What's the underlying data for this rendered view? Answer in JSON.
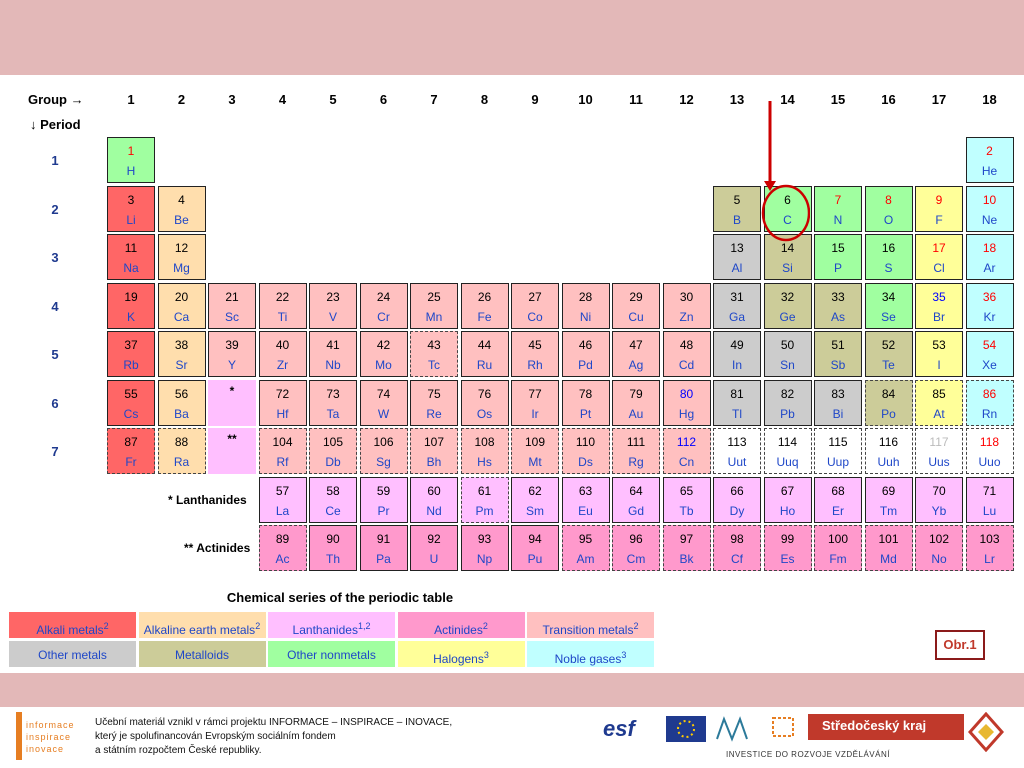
{
  "header": {
    "group_label": "Group →",
    "period_label": "↓ Period"
  },
  "groups": [
    "1",
    "2",
    "3",
    "4",
    "5",
    "6",
    "7",
    "8",
    "9",
    "10",
    "11",
    "12",
    "13",
    "14",
    "15",
    "16",
    "17",
    "18"
  ],
  "periods": [
    "1",
    "2",
    "3",
    "4",
    "5",
    "6",
    "7"
  ],
  "colors": {
    "alkali": "#ff6666",
    "alkaline": "#ffdead",
    "lanthanide": "#ffbfff",
    "actinide": "#ff99cc",
    "transition": "#ffc0c0",
    "poor": "#cccccc",
    "metalloid": "#cccc99",
    "nonmetal": "#a0ffa0",
    "halogen": "#ffff99",
    "noble": "#c0ffff",
    "unknown": "#ffffff"
  },
  "elements": [
    {
      "n": "1",
      "s": "H",
      "g": 1,
      "p": 1,
      "c": "nonmetal",
      "nc": "#ff0000"
    },
    {
      "n": "2",
      "s": "He",
      "g": 18,
      "p": 1,
      "c": "noble",
      "nc": "#ff0000"
    },
    {
      "n": "3",
      "s": "Li",
      "g": 1,
      "p": 2,
      "c": "alkali",
      "nc": "#000"
    },
    {
      "n": "4",
      "s": "Be",
      "g": 2,
      "p": 2,
      "c": "alkaline",
      "nc": "#000"
    },
    {
      "n": "5",
      "s": "B",
      "g": 13,
      "p": 2,
      "c": "metalloid",
      "nc": "#000"
    },
    {
      "n": "6",
      "s": "C",
      "g": 14,
      "p": 2,
      "c": "nonmetal",
      "nc": "#000"
    },
    {
      "n": "7",
      "s": "N",
      "g": 15,
      "p": 2,
      "c": "nonmetal",
      "nc": "#ff0000"
    },
    {
      "n": "8",
      "s": "O",
      "g": 16,
      "p": 2,
      "c": "nonmetal",
      "nc": "#ff0000"
    },
    {
      "n": "9",
      "s": "F",
      "g": 17,
      "p": 2,
      "c": "halogen",
      "nc": "#ff0000"
    },
    {
      "n": "10",
      "s": "Ne",
      "g": 18,
      "p": 2,
      "c": "noble",
      "nc": "#ff0000"
    },
    {
      "n": "11",
      "s": "Na",
      "g": 1,
      "p": 3,
      "c": "alkali",
      "nc": "#000"
    },
    {
      "n": "12",
      "s": "Mg",
      "g": 2,
      "p": 3,
      "c": "alkaline",
      "nc": "#000"
    },
    {
      "n": "13",
      "s": "Al",
      "g": 13,
      "p": 3,
      "c": "poor",
      "nc": "#000"
    },
    {
      "n": "14",
      "s": "Si",
      "g": 14,
      "p": 3,
      "c": "metalloid",
      "nc": "#000"
    },
    {
      "n": "15",
      "s": "P",
      "g": 15,
      "p": 3,
      "c": "nonmetal",
      "nc": "#000"
    },
    {
      "n": "16",
      "s": "S",
      "g": 16,
      "p": 3,
      "c": "nonmetal",
      "nc": "#000"
    },
    {
      "n": "17",
      "s": "Cl",
      "g": 17,
      "p": 3,
      "c": "halogen",
      "nc": "#ff0000"
    },
    {
      "n": "18",
      "s": "Ar",
      "g": 18,
      "p": 3,
      "c": "noble",
      "nc": "#ff0000"
    },
    {
      "n": "19",
      "s": "K",
      "g": 1,
      "p": 4,
      "c": "alkali",
      "nc": "#000"
    },
    {
      "n": "20",
      "s": "Ca",
      "g": 2,
      "p": 4,
      "c": "alkaline",
      "nc": "#000"
    },
    {
      "n": "21",
      "s": "Sc",
      "g": 3,
      "p": 4,
      "c": "transition",
      "nc": "#000"
    },
    {
      "n": "22",
      "s": "Ti",
      "g": 4,
      "p": 4,
      "c": "transition",
      "nc": "#000"
    },
    {
      "n": "23",
      "s": "V",
      "g": 5,
      "p": 4,
      "c": "transition",
      "nc": "#000"
    },
    {
      "n": "24",
      "s": "Cr",
      "g": 6,
      "p": 4,
      "c": "transition",
      "nc": "#000"
    },
    {
      "n": "25",
      "s": "Mn",
      "g": 7,
      "p": 4,
      "c": "transition",
      "nc": "#000"
    },
    {
      "n": "26",
      "s": "Fe",
      "g": 8,
      "p": 4,
      "c": "transition",
      "nc": "#000"
    },
    {
      "n": "27",
      "s": "Co",
      "g": 9,
      "p": 4,
      "c": "transition",
      "nc": "#000"
    },
    {
      "n": "28",
      "s": "Ni",
      "g": 10,
      "p": 4,
      "c": "transition",
      "nc": "#000"
    },
    {
      "n": "29",
      "s": "Cu",
      "g": 11,
      "p": 4,
      "c": "transition",
      "nc": "#000"
    },
    {
      "n": "30",
      "s": "Zn",
      "g": 12,
      "p": 4,
      "c": "transition",
      "nc": "#000"
    },
    {
      "n": "31",
      "s": "Ga",
      "g": 13,
      "p": 4,
      "c": "poor",
      "nc": "#000"
    },
    {
      "n": "32",
      "s": "Ge",
      "g": 14,
      "p": 4,
      "c": "metalloid",
      "nc": "#000"
    },
    {
      "n": "33",
      "s": "As",
      "g": 15,
      "p": 4,
      "c": "metalloid",
      "nc": "#000"
    },
    {
      "n": "34",
      "s": "Se",
      "g": 16,
      "p": 4,
      "c": "nonmetal",
      "nc": "#000"
    },
    {
      "n": "35",
      "s": "Br",
      "g": 17,
      "p": 4,
      "c": "halogen",
      "nc": "#0000ff"
    },
    {
      "n": "36",
      "s": "Kr",
      "g": 18,
      "p": 4,
      "c": "noble",
      "nc": "#ff0000"
    },
    {
      "n": "37",
      "s": "Rb",
      "g": 1,
      "p": 5,
      "c": "alkali",
      "nc": "#000"
    },
    {
      "n": "38",
      "s": "Sr",
      "g": 2,
      "p": 5,
      "c": "alkaline",
      "nc": "#000"
    },
    {
      "n": "39",
      "s": "Y",
      "g": 3,
      "p": 5,
      "c": "transition",
      "nc": "#000"
    },
    {
      "n": "40",
      "s": "Zr",
      "g": 4,
      "p": 5,
      "c": "transition",
      "nc": "#000"
    },
    {
      "n": "41",
      "s": "Nb",
      "g": 5,
      "p": 5,
      "c": "transition",
      "nc": "#000"
    },
    {
      "n": "42",
      "s": "Mo",
      "g": 6,
      "p": 5,
      "c": "transition",
      "nc": "#000"
    },
    {
      "n": "43",
      "s": "Tc",
      "g": 7,
      "p": 5,
      "c": "transition",
      "nc": "#000",
      "d": true
    },
    {
      "n": "44",
      "s": "Ru",
      "g": 8,
      "p": 5,
      "c": "transition",
      "nc": "#000"
    },
    {
      "n": "45",
      "s": "Rh",
      "g": 9,
      "p": 5,
      "c": "transition",
      "nc": "#000"
    },
    {
      "n": "46",
      "s": "Pd",
      "g": 10,
      "p": 5,
      "c": "transition",
      "nc": "#000"
    },
    {
      "n": "47",
      "s": "Ag",
      "g": 11,
      "p": 5,
      "c": "transition",
      "nc": "#000"
    },
    {
      "n": "48",
      "s": "Cd",
      "g": 12,
      "p": 5,
      "c": "transition",
      "nc": "#000"
    },
    {
      "n": "49",
      "s": "In",
      "g": 13,
      "p": 5,
      "c": "poor",
      "nc": "#000"
    },
    {
      "n": "50",
      "s": "Sn",
      "g": 14,
      "p": 5,
      "c": "poor",
      "nc": "#000"
    },
    {
      "n": "51",
      "s": "Sb",
      "g": 15,
      "p": 5,
      "c": "metalloid",
      "nc": "#000"
    },
    {
      "n": "52",
      "s": "Te",
      "g": 16,
      "p": 5,
      "c": "metalloid",
      "nc": "#000"
    },
    {
      "n": "53",
      "s": "I",
      "g": 17,
      "p": 5,
      "c": "halogen",
      "nc": "#000"
    },
    {
      "n": "54",
      "s": "Xe",
      "g": 18,
      "p": 5,
      "c": "noble",
      "nc": "#ff0000"
    },
    {
      "n": "55",
      "s": "Cs",
      "g": 1,
      "p": 6,
      "c": "alkali",
      "nc": "#000"
    },
    {
      "n": "56",
      "s": "Ba",
      "g": 2,
      "p": 6,
      "c": "alkaline",
      "nc": "#000"
    },
    {
      "n": "72",
      "s": "Hf",
      "g": 4,
      "p": 6,
      "c": "transition",
      "nc": "#000"
    },
    {
      "n": "73",
      "s": "Ta",
      "g": 5,
      "p": 6,
      "c": "transition",
      "nc": "#000"
    },
    {
      "n": "74",
      "s": "W",
      "g": 6,
      "p": 6,
      "c": "transition",
      "nc": "#000"
    },
    {
      "n": "75",
      "s": "Re",
      "g": 7,
      "p": 6,
      "c": "transition",
      "nc": "#000"
    },
    {
      "n": "76",
      "s": "Os",
      "g": 8,
      "p": 6,
      "c": "transition",
      "nc": "#000"
    },
    {
      "n": "77",
      "s": "Ir",
      "g": 9,
      "p": 6,
      "c": "transition",
      "nc": "#000"
    },
    {
      "n": "78",
      "s": "Pt",
      "g": 10,
      "p": 6,
      "c": "transition",
      "nc": "#000"
    },
    {
      "n": "79",
      "s": "Au",
      "g": 11,
      "p": 6,
      "c": "transition",
      "nc": "#000"
    },
    {
      "n": "80",
      "s": "Hg",
      "g": 12,
      "p": 6,
      "c": "transition",
      "nc": "#0000ff"
    },
    {
      "n": "81",
      "s": "Tl",
      "g": 13,
      "p": 6,
      "c": "poor",
      "nc": "#000"
    },
    {
      "n": "82",
      "s": "Pb",
      "g": 14,
      "p": 6,
      "c": "poor",
      "nc": "#000"
    },
    {
      "n": "83",
      "s": "Bi",
      "g": 15,
      "p": 6,
      "c": "poor",
      "nc": "#000"
    },
    {
      "n": "84",
      "s": "Po",
      "g": 16,
      "p": 6,
      "c": "metalloid",
      "nc": "#000",
      "d": true
    },
    {
      "n": "85",
      "s": "At",
      "g": 17,
      "p": 6,
      "c": "halogen",
      "nc": "#000",
      "d": true
    },
    {
      "n": "86",
      "s": "Rn",
      "g": 18,
      "p": 6,
      "c": "noble",
      "nc": "#ff0000",
      "d": true
    },
    {
      "n": "87",
      "s": "Fr",
      "g": 1,
      "p": 7,
      "c": "alkali",
      "nc": "#000",
      "d": true
    },
    {
      "n": "88",
      "s": "Ra",
      "g": 2,
      "p": 7,
      "c": "alkaline",
      "nc": "#000",
      "d": true
    },
    {
      "n": "104",
      "s": "Rf",
      "g": 4,
      "p": 7,
      "c": "transition",
      "nc": "#000",
      "d": true
    },
    {
      "n": "105",
      "s": "Db",
      "g": 5,
      "p": 7,
      "c": "transition",
      "nc": "#000",
      "d": true
    },
    {
      "n": "106",
      "s": "Sg",
      "g": 6,
      "p": 7,
      "c": "transition",
      "nc": "#000",
      "d": true
    },
    {
      "n": "107",
      "s": "Bh",
      "g": 7,
      "p": 7,
      "c": "transition",
      "nc": "#000",
      "d": true
    },
    {
      "n": "108",
      "s": "Hs",
      "g": 8,
      "p": 7,
      "c": "transition",
      "nc": "#000",
      "d": true
    },
    {
      "n": "109",
      "s": "Mt",
      "g": 9,
      "p": 7,
      "c": "transition",
      "nc": "#000",
      "d": true
    },
    {
      "n": "110",
      "s": "Ds",
      "g": 10,
      "p": 7,
      "c": "transition",
      "nc": "#000",
      "d": true
    },
    {
      "n": "111",
      "s": "Rg",
      "g": 11,
      "p": 7,
      "c": "transition",
      "nc": "#000",
      "d": true
    },
    {
      "n": "112",
      "s": "Cn",
      "g": 12,
      "p": 7,
      "c": "transition",
      "nc": "#0000ff",
      "d": true
    },
    {
      "n": "113",
      "s": "Uut",
      "g": 13,
      "p": 7,
      "c": "unknown",
      "nc": "#000",
      "d": true
    },
    {
      "n": "114",
      "s": "Uuq",
      "g": 14,
      "p": 7,
      "c": "unknown",
      "nc": "#000",
      "d": true
    },
    {
      "n": "115",
      "s": "Uup",
      "g": 15,
      "p": 7,
      "c": "unknown",
      "nc": "#000",
      "d": true
    },
    {
      "n": "116",
      "s": "Uuh",
      "g": 16,
      "p": 7,
      "c": "unknown",
      "nc": "#000",
      "d": true
    },
    {
      "n": "117",
      "s": "Uus",
      "g": 17,
      "p": 7,
      "c": "unknown",
      "nc": "#bbbbbb",
      "d": true
    },
    {
      "n": "118",
      "s": "Uuo",
      "g": 18,
      "p": 7,
      "c": "unknown",
      "nc": "#ff0000",
      "d": true
    }
  ],
  "placeholders": [
    {
      "label": "*",
      "g": 3,
      "p": 6
    },
    {
      "label": "**",
      "g": 3,
      "p": 7
    }
  ],
  "series_rows": [
    {
      "label": "* Lanthanides",
      "c": "lanthanide",
      "dashed": false,
      "items": [
        [
          "57",
          "La"
        ],
        [
          "58",
          "Ce"
        ],
        [
          "59",
          "Pr"
        ],
        [
          "60",
          "Nd"
        ],
        [
          "61",
          "Pm"
        ],
        [
          "62",
          "Sm"
        ],
        [
          "63",
          "Eu"
        ],
        [
          "64",
          "Gd"
        ],
        [
          "65",
          "Tb"
        ],
        [
          "66",
          "Dy"
        ],
        [
          "67",
          "Ho"
        ],
        [
          "68",
          "Er"
        ],
        [
          "69",
          "Tm"
        ],
        [
          "70",
          "Yb"
        ],
        [
          "71",
          "Lu"
        ]
      ],
      "dashedIdx": [
        4
      ]
    },
    {
      "label": "** Actinides",
      "c": "actinide",
      "dashed": true,
      "items": [
        [
          "89",
          "Ac"
        ],
        [
          "90",
          "Th"
        ],
        [
          "91",
          "Pa"
        ],
        [
          "92",
          "U"
        ],
        [
          "93",
          "Np"
        ],
        [
          "94",
          "Pu"
        ],
        [
          "95",
          "Am"
        ],
        [
          "96",
          "Cm"
        ],
        [
          "97",
          "Bk"
        ],
        [
          "98",
          "Cf"
        ],
        [
          "99",
          "Es"
        ],
        [
          "100",
          "Fm"
        ],
        [
          "101",
          "Md"
        ],
        [
          "102",
          "No"
        ],
        [
          "103",
          "Lr"
        ]
      ],
      "solidIdx": [
        1,
        2,
        3,
        4,
        5
      ]
    }
  ],
  "legend": {
    "title": "Chemical series of the periodic table",
    "row1": [
      {
        "text": "Alkali metals",
        "sup": "2",
        "c": "alkali"
      },
      {
        "text": "Alkaline earth metals",
        "sup": "2",
        "c": "alkaline"
      },
      {
        "text": "Lanthanides",
        "sup": "1,2",
        "c": "lanthanide"
      },
      {
        "text": "Actinides",
        "sup": "2",
        "c": "actinide"
      },
      {
        "text": "Transition metals",
        "sup": "2",
        "c": "transition"
      }
    ],
    "row2": [
      {
        "text": "Other metals",
        "sup": "",
        "c": "poor"
      },
      {
        "text": "Metalloids",
        "sup": "",
        "c": "metalloid"
      },
      {
        "text": "Other nonmetals",
        "sup": "",
        "c": "nonmetal"
      },
      {
        "text": "Halogens",
        "sup": "3",
        "c": "halogen"
      },
      {
        "text": "Noble gases",
        "sup": "3",
        "c": "noble"
      }
    ]
  },
  "figure_label": "Obr.1",
  "footer": {
    "line1": "Učební materiál vznikl v rámci projektu INFORMACE – INSPIRACE – INOVACE,",
    "line2": "který je spolufinancován Evropským sociálním fondem",
    "line3": "a státním rozpočtem České republiky.",
    "logo_left": [
      "informace",
      "inspirace",
      "inovace"
    ],
    "logo_esf": "esf",
    "region_name": "Středočeský kraj",
    "invest": "INVESTICE DO ROZVOJE VZDĚLÁVÁNÍ"
  }
}
